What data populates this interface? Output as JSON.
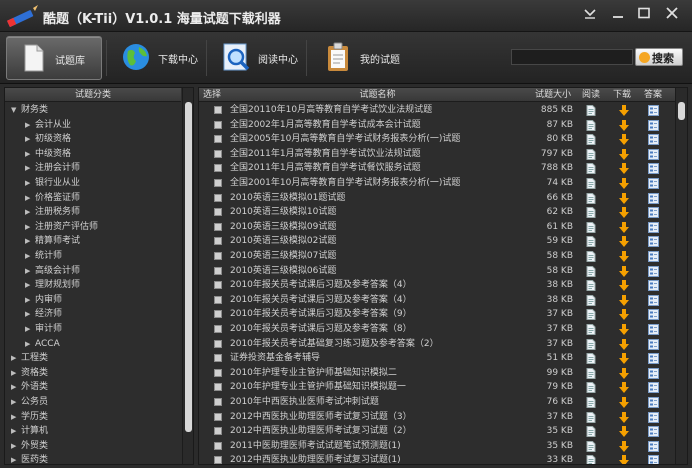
{
  "app": {
    "title": "酷题（K-Tii）V1.0.1 海量试题下载利器",
    "window_controls": [
      "minimize-to-tray",
      "minimize",
      "maximize",
      "close"
    ]
  },
  "toolbar": {
    "tabs": [
      {
        "label": "试题库",
        "icon": "document-icon",
        "active": true
      },
      {
        "label": "下载中心",
        "icon": "globe-icon",
        "active": false
      },
      {
        "label": "阅读中心",
        "icon": "magnifier-icon",
        "active": false
      },
      {
        "label": "我的试题",
        "icon": "clipboard-icon",
        "active": false
      }
    ],
    "search": {
      "placeholder": "",
      "button_label": "搜索"
    }
  },
  "category_panel": {
    "header": "试题分类",
    "items": [
      {
        "label": "财务类",
        "level": 0,
        "expanded": true
      },
      {
        "label": "会计从业",
        "level": 1
      },
      {
        "label": "初级资格",
        "level": 1
      },
      {
        "label": "中级资格",
        "level": 1
      },
      {
        "label": "注册会计师",
        "level": 1
      },
      {
        "label": "银行业从业",
        "level": 1
      },
      {
        "label": "价格鉴证师",
        "level": 1
      },
      {
        "label": "注册税务师",
        "level": 1
      },
      {
        "label": "注册资产评估师",
        "level": 1
      },
      {
        "label": "精算师考试",
        "level": 1
      },
      {
        "label": "统计师",
        "level": 1
      },
      {
        "label": "高级会计师",
        "level": 1
      },
      {
        "label": "理财规划师",
        "level": 1
      },
      {
        "label": "内审师",
        "level": 1
      },
      {
        "label": "经济师",
        "level": 1
      },
      {
        "label": "审计师",
        "level": 1
      },
      {
        "label": "ACCA",
        "level": 1
      },
      {
        "label": "工程类",
        "level": 0
      },
      {
        "label": "资格类",
        "level": 0
      },
      {
        "label": "外语类",
        "level": 0
      },
      {
        "label": "公务员",
        "level": 0
      },
      {
        "label": "学历类",
        "level": 0
      },
      {
        "label": "计算机",
        "level": 0
      },
      {
        "label": "外贸类",
        "level": 0
      },
      {
        "label": "医药类",
        "level": 0
      }
    ]
  },
  "table": {
    "columns": [
      "选择",
      "试题名称",
      "试题大小",
      "阅读",
      "下载",
      "答案"
    ],
    "rows": [
      {
        "name": "全国20110年10月高等教育自学考试饮业法规试题",
        "size": "885 KB"
      },
      {
        "name": "全国2002年1月高等教育自学考试成本会计试题",
        "size": "87 KB"
      },
      {
        "name": "全国2005年10月高等教育自学考试财务报表分析(一)试题",
        "size": "80 KB"
      },
      {
        "name": "全国2011年1月高等教育自学考试饮业法规试题",
        "size": "797 KB"
      },
      {
        "name": "全国2011年1月高等教育自学考试餐饮服务试题",
        "size": "788 KB"
      },
      {
        "name": "全国2001年10月高等教育自学考试财务报表分析(一)试题",
        "size": "74 KB"
      },
      {
        "name": "2010英语三级模拟01题试题",
        "size": "66 KB"
      },
      {
        "name": "2010英语三级模拟10试题",
        "size": "62 KB"
      },
      {
        "name": "2010英语三级模拟09试题",
        "size": "61 KB"
      },
      {
        "name": "2010英语三级模拟02试题",
        "size": "59 KB"
      },
      {
        "name": "2010英语三级模拟07试题",
        "size": "58 KB"
      },
      {
        "name": "2010英语三级模拟06试题",
        "size": "58 KB"
      },
      {
        "name": "2010年报关员考试课后习题及参考答案（4）",
        "size": "38 KB"
      },
      {
        "name": "2010年报关员考试课后习题及参考答案（4）",
        "size": "38 KB"
      },
      {
        "name": "2010年报关员考试课后习题及参考答案（9）",
        "size": "37 KB"
      },
      {
        "name": "2010年报关员考试课后习题及参考答案（8）",
        "size": "37 KB"
      },
      {
        "name": "2010年报关员考试基础复习练习题及参考答案（2）",
        "size": "37 KB"
      },
      {
        "name": "证券投资基金备考辅导",
        "size": "51 KB"
      },
      {
        "name": "2010年护理专业主管护师基础知识模拟二",
        "size": "99 KB"
      },
      {
        "name": "2010年护理专业主管护师基础知识模拟题一",
        "size": "79 KB"
      },
      {
        "name": "2010年中西医执业医师考试冲刺试题",
        "size": "76 KB"
      },
      {
        "name": "2012中西医执业助理医师考试复习试题（3）",
        "size": "37 KB"
      },
      {
        "name": "2012中西医执业助理医师考试复习试题（2）",
        "size": "35 KB"
      },
      {
        "name": "2011中医助理医师考试试题笔试预测题(1)",
        "size": "35 KB"
      },
      {
        "name": "2012中西医执业助理医师考试复习试题(1)",
        "size": "33 KB"
      }
    ]
  },
  "colors": {
    "background": "#2b2b2b",
    "download_arrow": "#f5a000",
    "page_icon": "#e8eef5"
  }
}
